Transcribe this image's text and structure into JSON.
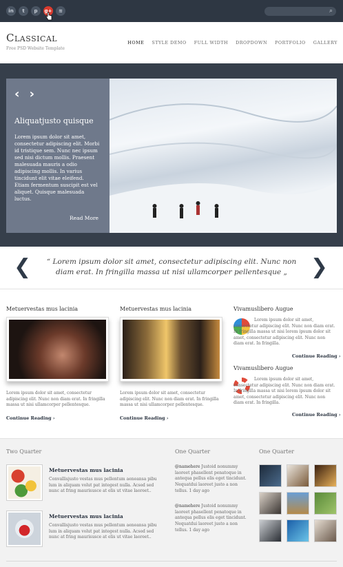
{
  "social": [
    {
      "icon": "linkedin-icon",
      "glyph": "in"
    },
    {
      "icon": "twitter-icon",
      "glyph": "t"
    },
    {
      "icon": "pinterest-icon",
      "glyph": "p"
    },
    {
      "icon": "google-plus-icon",
      "glyph": "g+"
    },
    {
      "icon": "rss-icon",
      "glyph": "≋"
    }
  ],
  "search": {
    "icon": "search-icon"
  },
  "header": {
    "logo": "Classical",
    "tagline": "Free PSD Website Template",
    "nav": [
      "HOME",
      "STYLE DEMO",
      "FULL WIDTH",
      "DROPDOWN",
      "PORTFOLIO",
      "GALLERY"
    ]
  },
  "slider": {
    "title": "Aliquatjusto quisque",
    "text": "Lorem ipsum dolor sit amet, consectetur adipiscing elit. Morbi id tristique sem. Nunc nec ipsum sed nisi dictum mollis. Praesent malesuada mauris a odio adipiscing mollis. In varius tincidunt elit vitae eleifend. Etiam fermentum suscipit est vel aliquet. Quisque malesuada luctus.",
    "more": "Read More"
  },
  "quote": {
    "text": "“ Lorem ipsum dolor sit amet, consectetur adipiscing elit. Nunc non diam erat. In fringilla massa ut nisi ullamcorper pellentesque „"
  },
  "features": {
    "col1": {
      "title": "Metuervestas mus lacinia",
      "text": "Lorem ipsum dolor sit amet, consectetur adipiscing elit. Nunc non diam erat. In fringilla massa ut nisi ullamcorper pellentesque.",
      "link": "Continue Reading"
    },
    "col2": {
      "title": "Metuervestas mus lacinia",
      "text": "Lorem ipsum dolor sit amet, consectetur adipiscing elit. Nunc non diam erat. In fringilla massa ut nisi ullamcorper pellentesque.",
      "link": "Continue Reading"
    },
    "col3a": {
      "title": "Vivamuslibero Augue",
      "text": "Lorem ipsum dolor sit amet, consectetur adipiscing elit. Nunc non diam erat. In fringilla massa ut nisi lorem ipsum dolor sit amet, consectetur adipiscing elit. Nunc non diam erat. In fringilla.",
      "link": "Continue Reading"
    },
    "col3b": {
      "title": "Vivamuslibero Augue",
      "text": "Lorem ipsum dolor sit amet, consectetur adipiscing elit. Nunc non diam erat. In fringilla massa ut nisi lorem ipsum dolor sit amet, consectetur adipiscing elit. Nunc non diam erat. In fringilla.",
      "link": "Continue Reading"
    }
  },
  "bottom": {
    "two_quarter": {
      "title": "Two Quarter",
      "items": [
        {
          "title": "Metuervestas mus lacinia",
          "text": "Convallisjusto vestas mus pellentum aeneansa pibu lum in aliquam volut pat integest nulla. Acsed sed nunc at fring maurisusce at elis ut vitae laoreet.."
        },
        {
          "title": "Metuervestas mus lacinia",
          "text": "Convallisjusto vestas mus pellentum aeneansa pibu lum in aliquam volut pat integest nulla. Acsed sed nunc at fring maurisusce at elis ut vitae laoreet.."
        }
      ]
    },
    "one_quarter_a": {
      "title": "One Quarter",
      "tweets": [
        {
          "handle": "@namehere",
          "text": " Justoid nonummy laoreet phasellent penatoque in antequa pellus elis eget tincidunt. Nequatdui laoreet justo a non tellus. 1 day ago"
        },
        {
          "handle": "@namehere",
          "text": " Justoid nonummy laoreet phasellent penatoque in antequa pellus elis eget tincidunt. Nequatdui laoreet justo a non tellus. 1 day ago"
        }
      ]
    },
    "one_quarter_b": {
      "title": "One Quarter"
    }
  }
}
